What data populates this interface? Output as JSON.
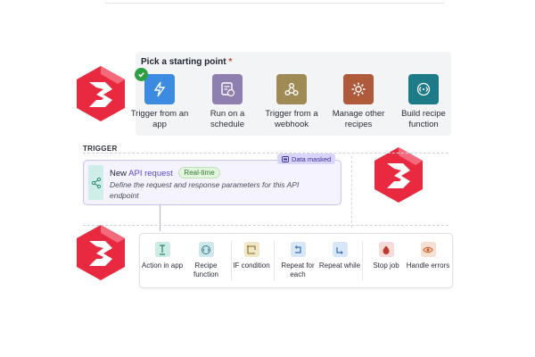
{
  "start": {
    "title": "Pick a starting point",
    "required_mark": "*",
    "options": [
      {
        "label": "Trigger from an app",
        "icon": "lightning-icon",
        "color": "#3d8be0",
        "selected": true
      },
      {
        "label": "Run on a schedule",
        "icon": "schedule-icon",
        "color": "#8f7fb0"
      },
      {
        "label": "Trigger from a webhook",
        "icon": "webhook-icon",
        "color": "#a08a55"
      },
      {
        "label": "Manage other recipes",
        "icon": "gear-icon",
        "color": "#b05a3c"
      },
      {
        "label": "Build recipe function",
        "icon": "function-icon",
        "color": "#1d7a88"
      }
    ]
  },
  "trigger": {
    "section_label": "TRIGGER",
    "prefix": "New",
    "api_text": "API request",
    "badge": "Real-time",
    "description": "Define the request and response parameters for this API endpoint",
    "masked_label": "Data masked"
  },
  "actions": [
    {
      "label": "Action in app",
      "icon": "action-icon",
      "bg": "#cdebe5",
      "fg": "#2e8b7a"
    },
    {
      "label": "Recipe function",
      "icon": "recipe-function-icon",
      "bg": "#cfe9ea",
      "fg": "#2e7c86"
    },
    {
      "label": "IF condition",
      "icon": "if-condition-icon",
      "bg": "#efe6c8",
      "fg": "#8a6d1f"
    },
    {
      "label": "Repeat for each",
      "icon": "repeat-each-icon",
      "bg": "#d7e7f8",
      "fg": "#3a6fb5"
    },
    {
      "label": "Repeat while",
      "icon": "repeat-while-icon",
      "bg": "#d7e7f8",
      "fg": "#3a6fb5"
    },
    {
      "label": "Stop job",
      "icon": "stop-icon",
      "bg": "#f7dada",
      "fg": "#c0392b"
    },
    {
      "label": "Handle errors",
      "icon": "eye-icon",
      "bg": "#f7e0d2",
      "fg": "#c05a25"
    }
  ],
  "brand_colors": {
    "logo": "#e8293f"
  }
}
